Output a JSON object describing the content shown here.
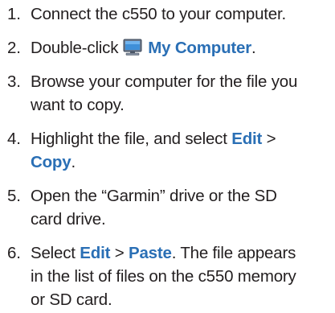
{
  "steps": [
    {
      "number": "1.",
      "line1": "Connect the c550 to your computer."
    },
    {
      "number": "2.",
      "prefix": "Double-click",
      "icon": "my-computer-icon",
      "ui_label": "My Computer",
      "suffix": "."
    },
    {
      "number": "3.",
      "line1": "Browse your computer for the file you",
      "line2": "want to copy."
    },
    {
      "number": "4.",
      "line1_prefix": "Highlight the file, and select",
      "ui_edit": "Edit",
      "separator": ">",
      "ui_copy": "Copy",
      "line2_suffix": "."
    },
    {
      "number": "5.",
      "line1": "Open the “Garmin” drive or the SD",
      "line2": "card drive."
    },
    {
      "number": "6.",
      "line1_prefix": "Select",
      "ui_edit": "Edit",
      "separator": ">",
      "ui_paste": "Paste",
      "line1_suffix": ". The file appears",
      "line2": "in the list of files on the c550 memory",
      "line3": "or SD card."
    }
  ],
  "colors": {
    "text": "#231f20",
    "ui_accent": "#2a6fb5"
  }
}
